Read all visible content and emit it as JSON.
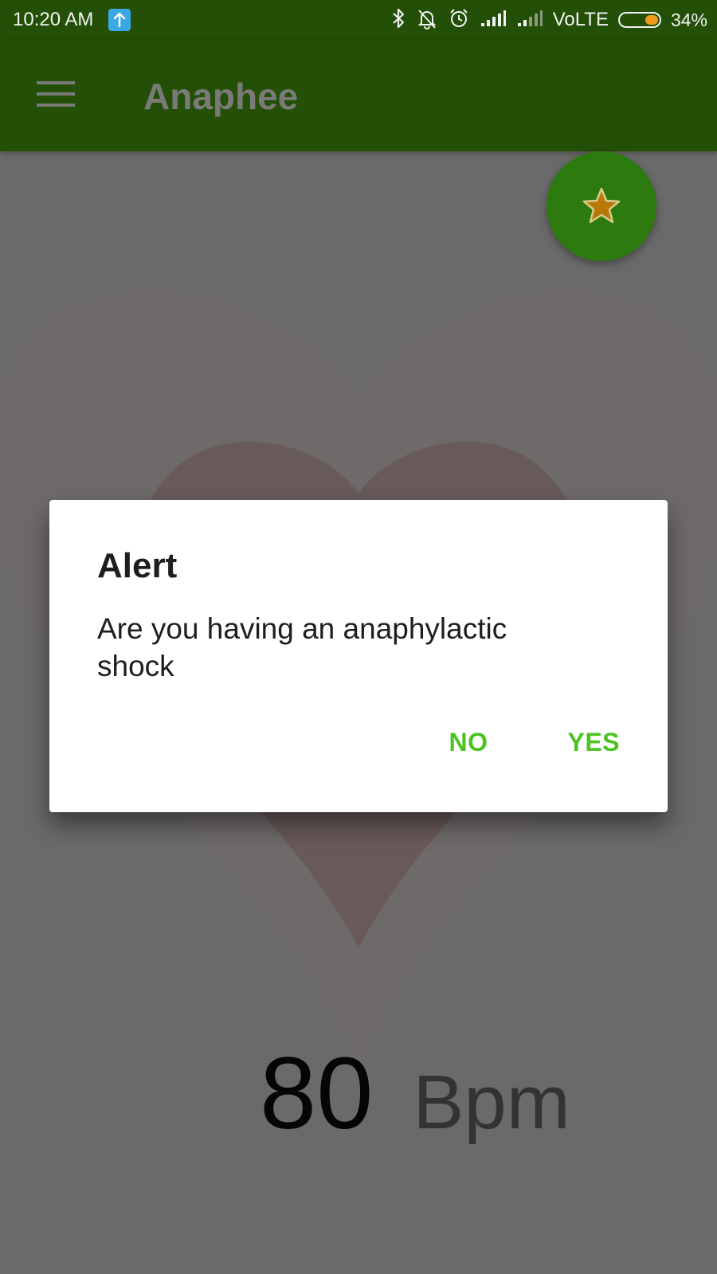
{
  "status_bar": {
    "time": "10:20 AM",
    "icons": [
      "upload-icon",
      "bluetooth-icon",
      "notifications-off-icon",
      "alarm-icon",
      "signal-icon",
      "signal-weak-icon"
    ],
    "carrier": "VoLTE",
    "battery_percent": "34%",
    "battery_level": 0.34,
    "battery_color": "#f29a1c"
  },
  "app_bar": {
    "menu_icon": "hamburger-menu-icon",
    "title": "Anaphee",
    "color": "#234f06"
  },
  "fab": {
    "icon": "star-icon",
    "color": "#2d7a0f"
  },
  "heart_rate": {
    "value": "80",
    "unit": "Bpm"
  },
  "dialog": {
    "title": "Alert",
    "message": "Are you having an anaphylactic shock",
    "negative_button": "NO",
    "positive_button": "YES",
    "button_color": "#4cc321"
  }
}
